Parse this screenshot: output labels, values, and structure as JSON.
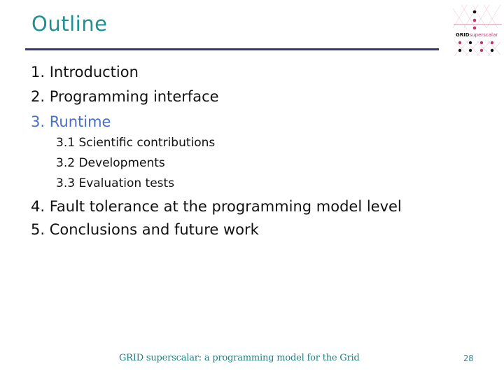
{
  "slide": {
    "title": "Outline",
    "colors": {
      "title": "#1f9090",
      "rule": "#36357a",
      "body_text": "#111111",
      "active_item": "#4a6ec4",
      "footer": "#1f8080",
      "logo_accent": "#c2356e"
    }
  },
  "logo": {
    "word1": "GRID",
    "word2": "superscalar",
    "icon": "grid-dots-logo-icon"
  },
  "outline": {
    "items": [
      {
        "number": "1.",
        "label": "Introduction",
        "active": false
      },
      {
        "number": "2.",
        "label": "Programming interface",
        "active": false
      },
      {
        "number": "3.",
        "label": "Runtime",
        "active": true
      },
      {
        "number": "4.",
        "label": "Fault tolerance at the programming model level",
        "active": false
      },
      {
        "number": "5.",
        "label": "Conclusions and future work",
        "active": false
      }
    ],
    "sub_items": [
      {
        "number": "3.1",
        "label": "Scientific contributions"
      },
      {
        "number": "3.2",
        "label": "Developments"
      },
      {
        "number": "3.3",
        "label": "Evaluation tests"
      }
    ]
  },
  "footer": {
    "text": "GRID superscalar: a programming model for the Grid",
    "page_number": "28"
  }
}
